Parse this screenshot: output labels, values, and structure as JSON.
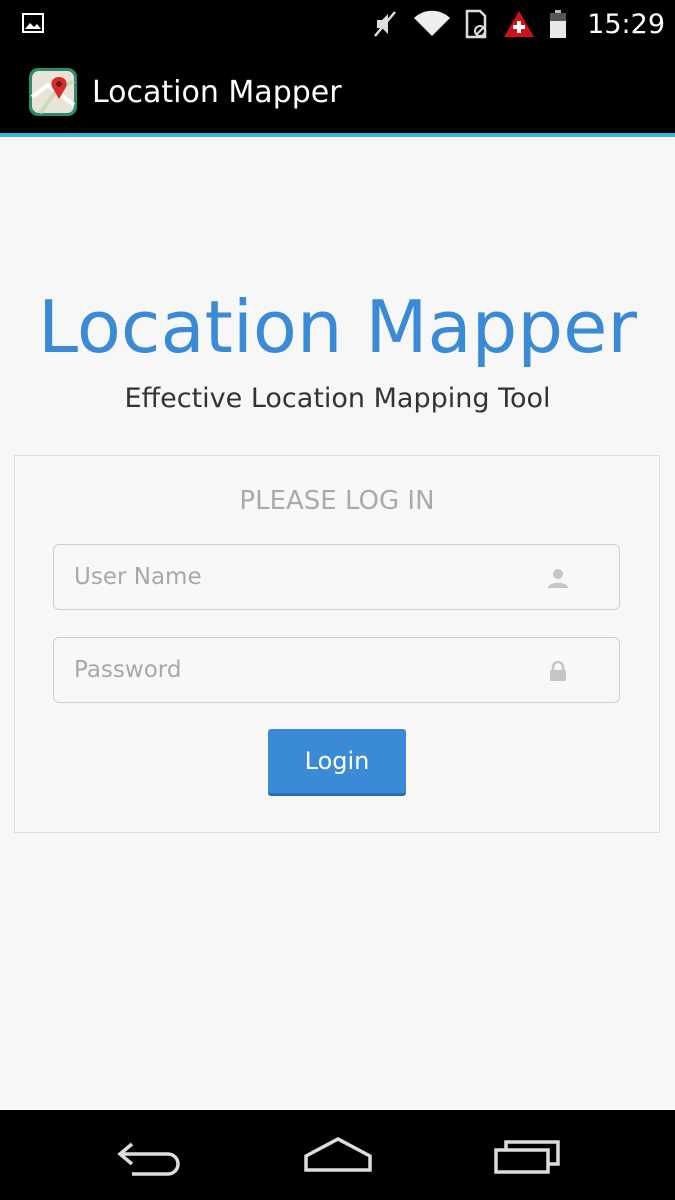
{
  "status_bar": {
    "time": "15:29",
    "icons": [
      "image-notification-icon",
      "mute-icon",
      "wifi-icon",
      "sim-icon",
      "alert-icon",
      "battery-icon"
    ]
  },
  "action_bar": {
    "title": "Location Mapper",
    "accent_color": "#33b5e5"
  },
  "hero": {
    "title": "Location Mapper",
    "subtitle": "Effective Location Mapping Tool",
    "title_color": "#3a8ad6"
  },
  "login": {
    "heading": "PLEASE LOG IN",
    "username_placeholder": "User Name",
    "password_placeholder": "Password",
    "button_label": "Login",
    "button_color": "#3a8ad6"
  },
  "nav_bar": {
    "buttons": [
      "back-icon",
      "home-icon",
      "recents-icon"
    ]
  }
}
